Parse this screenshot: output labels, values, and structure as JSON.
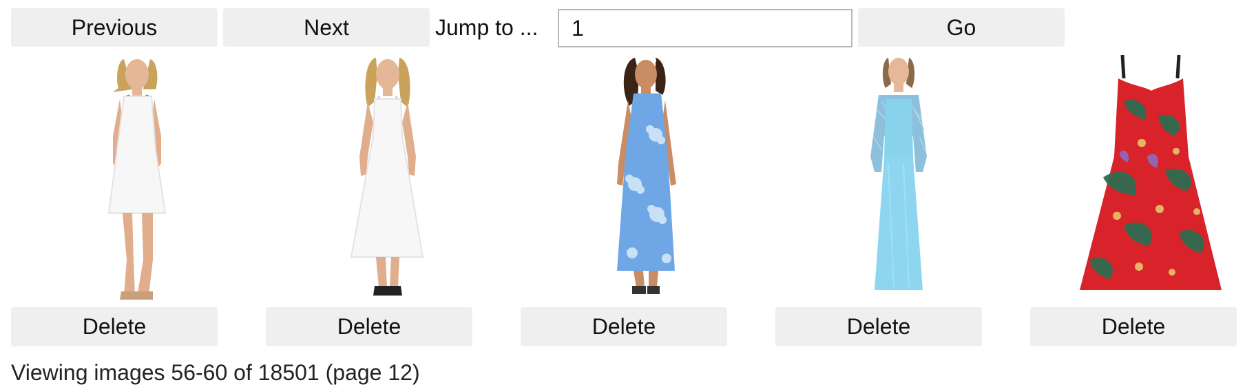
{
  "toolbar": {
    "previous_label": "Previous",
    "next_label": "Next",
    "jump_label": "Jump to ...",
    "jump_value": "1",
    "go_label": "Go"
  },
  "gallery": {
    "items": [
      {
        "name": "white sundress with necklace",
        "delete_label": "Delete"
      },
      {
        "name": "white empire maxi dress",
        "delete_label": "Delete"
      },
      {
        "name": "blue hibiscus maxi dress",
        "delete_label": "Delete"
      },
      {
        "name": "light blue lace bolero gown",
        "delete_label": "Delete"
      },
      {
        "name": "red floral parrot sundress",
        "delete_label": "Delete"
      }
    ]
  },
  "status": {
    "text": "Viewing images 56-60 of 18501 (page 12)"
  },
  "colors": {
    "button_bg": "#efefef",
    "input_border": "#b7b7b7",
    "dress_white": "#f8f8f8",
    "dress_blue": "#6ea6e6",
    "dress_light_blue": "#8ed6f0",
    "dress_red": "#d8232a"
  }
}
